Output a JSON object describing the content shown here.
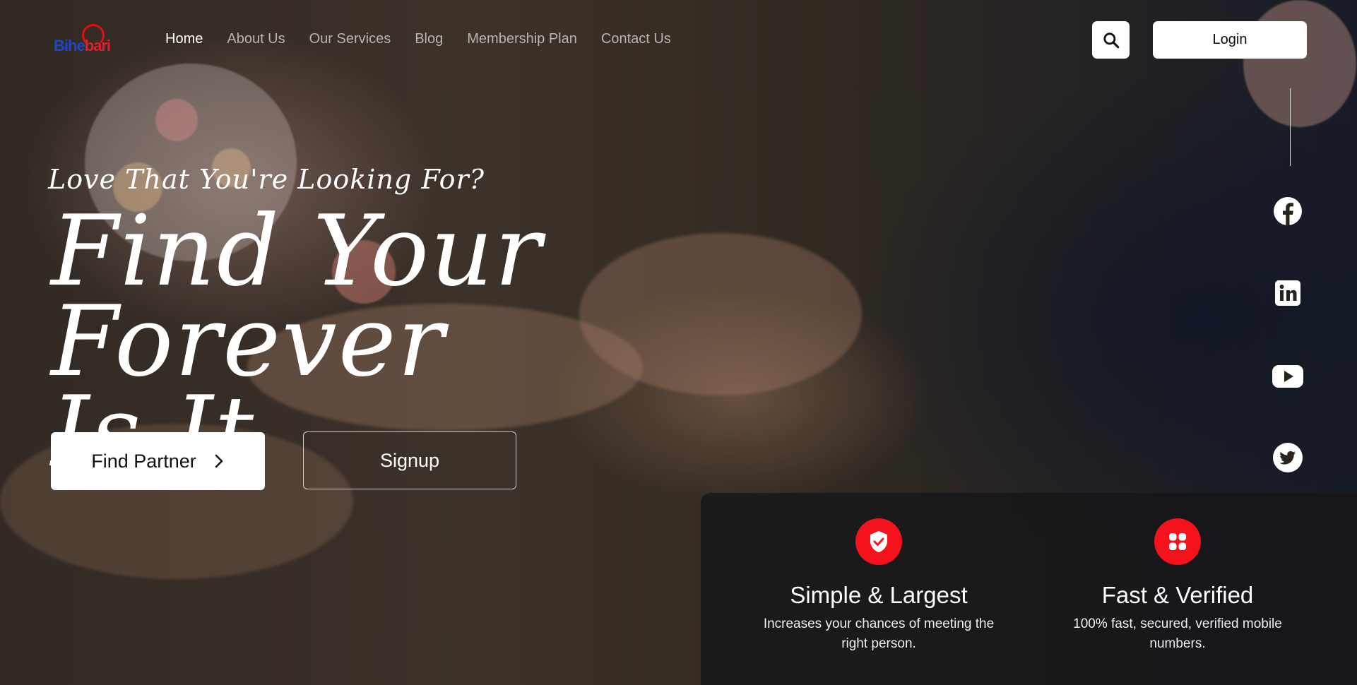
{
  "brand": {
    "part1": "Bihe",
    "part2": "bari"
  },
  "nav": {
    "items": [
      {
        "label": "Home"
      },
      {
        "label": "About Us"
      },
      {
        "label": "Our Services"
      },
      {
        "label": "Blog"
      },
      {
        "label": "Membership Plan"
      },
      {
        "label": "Contact Us"
      }
    ],
    "active": "Home"
  },
  "header": {
    "search_icon": "search-icon",
    "login_label": "Login"
  },
  "hero": {
    "tagline": "Love That You're Looking For?",
    "headline_line1": "Find Your Forever",
    "headline_line2": "Is It",
    "find_partner_label": "Find Partner",
    "signup_label": "Signup"
  },
  "social": [
    "facebook-icon",
    "linkedin-icon",
    "youtube-icon",
    "twitter-icon"
  ],
  "features": [
    {
      "icon": "shield-check-icon",
      "title": "Simple & Largest",
      "desc": "Increases your chances of meeting the right person."
    },
    {
      "icon": "grid-icon",
      "title": "Fast & Verified",
      "desc": "100% fast, secured, verified mobile numbers."
    }
  ],
  "colors": {
    "accent": "#f5121c",
    "brand_blue": "#1f46c4",
    "brand_red": "#e0202a"
  }
}
